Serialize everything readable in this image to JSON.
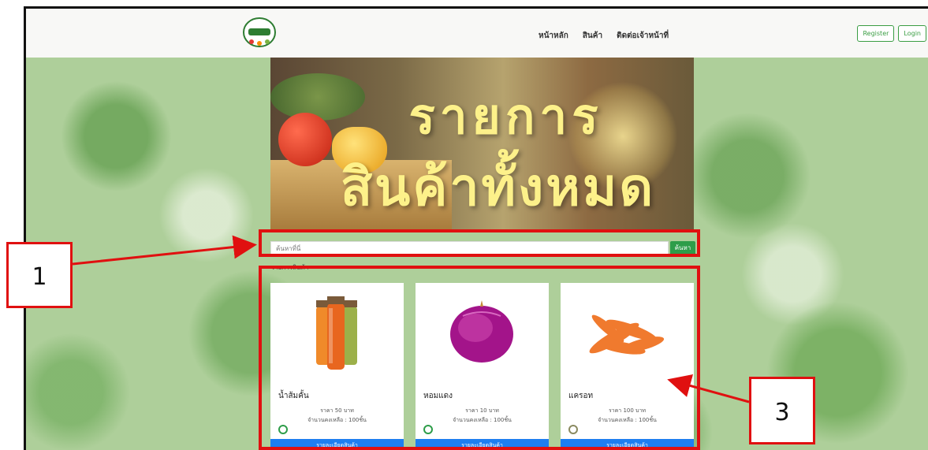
{
  "nav": {
    "links": [
      "หน้าหลัก",
      "สินค้า",
      "ติดต่อเจ้าหน้าที่"
    ],
    "register": "Register",
    "login": "Login"
  },
  "hero": {
    "line1": "รายการ",
    "line2": "สินค้าทั้งหมด"
  },
  "search": {
    "placeholder": "ค้นหาที่นี่",
    "button": "ค้นหา"
  },
  "list_label": "รายการสินค้า",
  "products": [
    {
      "name": "น้ำส้มคั้น",
      "price": "ราคา 50 บาท",
      "stock": "จำนวนคงเหลือ : 100ชิ้น",
      "button": "รายละเอียดสินค้า"
    },
    {
      "name": "หอมแดง",
      "price": "ราคา 10 บาท",
      "stock": "จำนวนคงเหลือ : 100ชิ้น",
      "button": "รายละเอียดสินค้า"
    },
    {
      "name": "แครอท",
      "price": "ราคา 100 บาท",
      "stock": "จำนวนคงเหลือ : 100ชิ้น",
      "button": "รายละเอียดสินค้า"
    }
  ],
  "annotations": {
    "label1": "1",
    "label3": "3"
  },
  "colors": {
    "search_button": "#2e9d4a",
    "card_button": "#1e7ef0",
    "annotation": "#e01010"
  }
}
